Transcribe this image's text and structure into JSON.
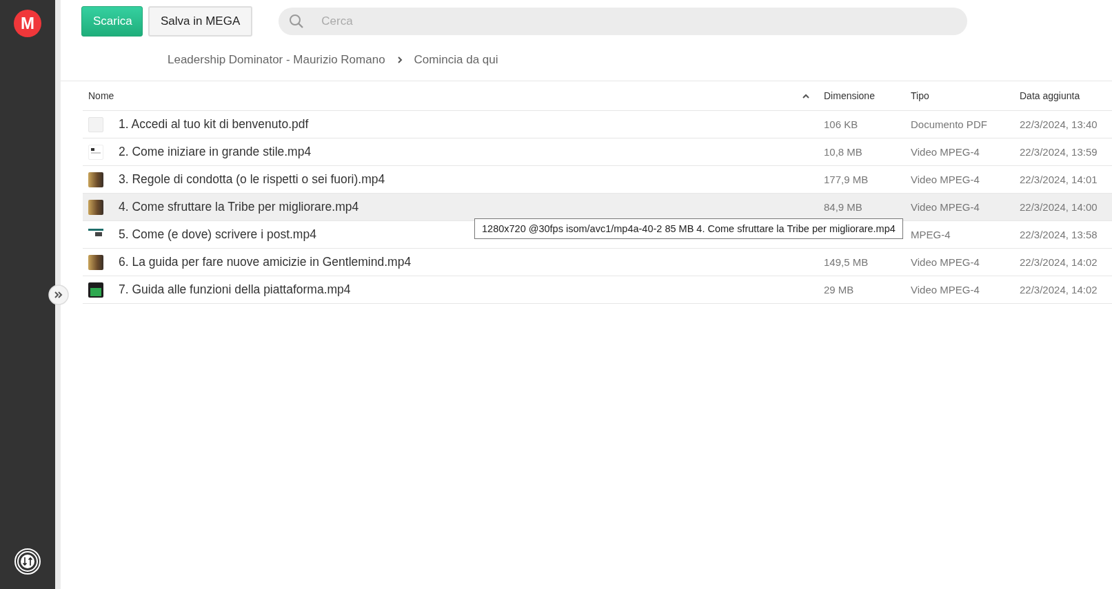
{
  "logo": {
    "letter": "M"
  },
  "toolbar": {
    "buttons": [
      {
        "label": "Scarica",
        "kind": "primary"
      },
      {
        "label": "Salva in MEGA",
        "kind": "secondary"
      }
    ],
    "search": {
      "placeholder": "Cerca"
    }
  },
  "breadcrumb": [
    "Leadership Dominator - Maurizio Romano",
    "Comincia da qui"
  ],
  "table": {
    "columns": [
      {
        "label": "Nome",
        "sorted": true
      },
      {
        "label": "Dimensione",
        "sorted": false
      },
      {
        "label": "Tipo",
        "sorted": false
      },
      {
        "label": "Data aggiunta",
        "sorted": false
      }
    ],
    "rows": [
      {
        "name": "1. Accedi al tuo kit di benvenuto.pdf",
        "size": "106 KB",
        "type": "Documento PDF",
        "date": "22/3/2024, 13:40",
        "kind": "blank",
        "highlighted": false
      },
      {
        "name": "2. Come iniziare in grande stile.mp4",
        "size": "10,8 MB",
        "type": "Video MPEG-4",
        "date": "22/3/2024, 13:59",
        "kind": "page",
        "highlighted": false
      },
      {
        "name": "3. Regole di condotta (o le rispetti o sei fuori).mp4",
        "size": "177,9 MB",
        "type": "Video MPEG-4",
        "date": "22/3/2024, 14:01",
        "kind": "photo",
        "highlighted": false
      },
      {
        "name": "4. Come sfruttare la Tribe per migliorare.mp4",
        "size": "84,9 MB",
        "type": "Video MPEG-4",
        "date": "22/3/2024, 14:00",
        "kind": "photo",
        "highlighted": true
      },
      {
        "name": "5. Come (e dove) scrivere i post.mp4",
        "type": "MPEG-4",
        "date": "22/3/2024, 13:58",
        "kind": "banner",
        "highlighted": false
      },
      {
        "name": "6. La guida per fare nuove amicizie in Gentlemind.mp4",
        "size": "149,5 MB",
        "type": "Video MPEG-4",
        "date": "22/3/2024, 14:02",
        "kind": "photo",
        "highlighted": false
      },
      {
        "name": "7. Guida alle funzioni della piattaforma.mp4",
        "size": "29 MB",
        "type": "Video MPEG-4",
        "date": "22/3/2024, 14:02",
        "kind": "green",
        "highlighted": false
      }
    ]
  },
  "tooltip": {
    "text": "1280x720 @30fps isom/avc1/mp4a-40-2 85 MB 4. Come sfruttare la Tribe per migliorare.mp4"
  }
}
